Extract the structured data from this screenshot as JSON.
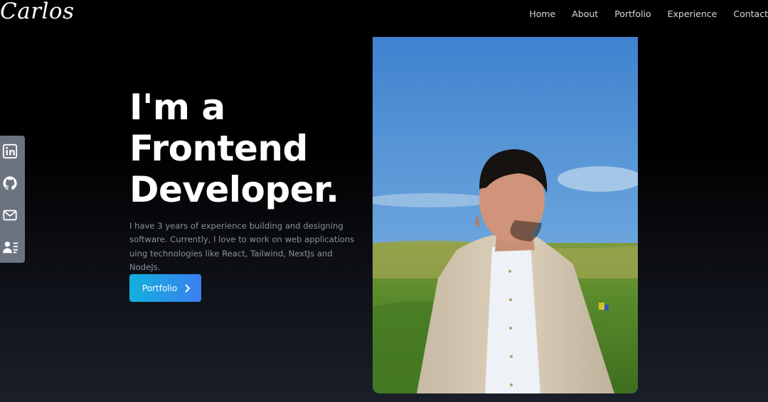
{
  "logo": "Carlos",
  "nav": {
    "items": [
      "Home",
      "About",
      "Portfolio",
      "Experience",
      "Contact"
    ]
  },
  "social": {
    "items": [
      {
        "icon": "linkedin-icon"
      },
      {
        "icon": "github-icon"
      },
      {
        "icon": "mail-icon"
      },
      {
        "icon": "resume-icon"
      }
    ]
  },
  "hero": {
    "headline_lines": [
      "I'm a",
      "Frontend",
      "Developer."
    ],
    "description": "I have 3 years of experience building and designing software. Currently, I love to work on web applications uing technologies like React, Tailwind, NextJs and NodeJs.",
    "button_label": "Portfolio",
    "button_icon": "chevron-right-icon"
  },
  "colors": {
    "accent_start": "#12b0dd",
    "accent_end": "#3b7ff0",
    "social_bar": "#6b7280"
  }
}
